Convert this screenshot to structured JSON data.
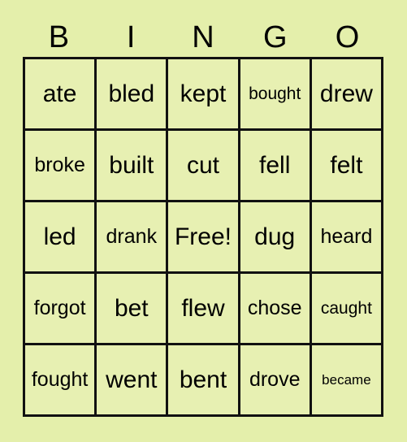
{
  "card": {
    "background_color": "#e4efab",
    "cell_color": "#e7f0b2",
    "line_color": "#111111",
    "text_color": "#000000"
  },
  "header": {
    "letters": [
      {
        "label": "B"
      },
      {
        "label": "I"
      },
      {
        "label": "N"
      },
      {
        "label": "G"
      },
      {
        "label": "O"
      }
    ]
  },
  "grid": {
    "columns": 5,
    "rows": 5,
    "cells": [
      [
        {
          "label": "ate",
          "size": "fs-lg"
        },
        {
          "label": "bled",
          "size": "fs-lg"
        },
        {
          "label": "kept",
          "size": "fs-lg"
        },
        {
          "label": "bought",
          "size": "fs-sm"
        },
        {
          "label": "drew",
          "size": "fs-lg"
        }
      ],
      [
        {
          "label": "broke",
          "size": "fs-md"
        },
        {
          "label": "built",
          "size": "fs-lg"
        },
        {
          "label": "cut",
          "size": "fs-lg"
        },
        {
          "label": "fell",
          "size": "fs-lg"
        },
        {
          "label": "felt",
          "size": "fs-lg"
        }
      ],
      [
        {
          "label": "led",
          "size": "fs-lg"
        },
        {
          "label": "drank",
          "size": "fs-md"
        },
        {
          "label": "Free!",
          "size": "fs-lg"
        },
        {
          "label": "dug",
          "size": "fs-lg"
        },
        {
          "label": "heard",
          "size": "fs-md"
        }
      ],
      [
        {
          "label": "forgot",
          "size": "fs-md"
        },
        {
          "label": "bet",
          "size": "fs-lg"
        },
        {
          "label": "flew",
          "size": "fs-lg"
        },
        {
          "label": "chose",
          "size": "fs-md"
        },
        {
          "label": "caught",
          "size": "fs-sm"
        }
      ],
      [
        {
          "label": "fought",
          "size": "fs-md"
        },
        {
          "label": "went",
          "size": "fs-lg"
        },
        {
          "label": "bent",
          "size": "fs-lg"
        },
        {
          "label": "drove",
          "size": "fs-md"
        },
        {
          "label": "became",
          "size": "fs-xs"
        }
      ]
    ]
  }
}
